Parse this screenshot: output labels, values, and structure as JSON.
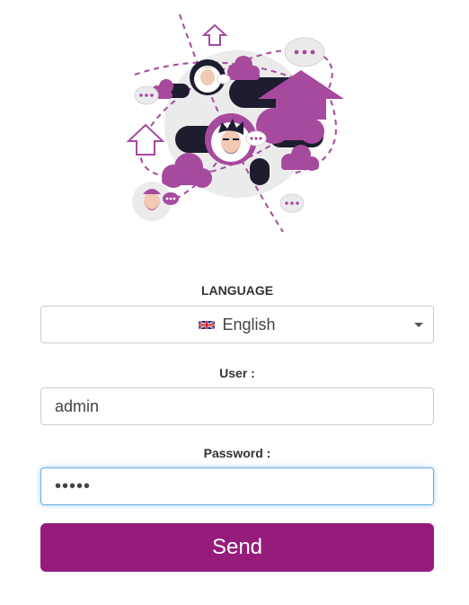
{
  "colors": {
    "accent": "#961c7c",
    "accent_light": "#a64a9e",
    "dark": "#1d1d2f",
    "focus_border": "#66afe9"
  },
  "illustration": {
    "icon": "chat-network-illustration"
  },
  "language": {
    "label": "LANGUAGE",
    "selected": "English",
    "flag_icon": "uk-flag-icon"
  },
  "user": {
    "label": "User :",
    "value": "admin"
  },
  "password": {
    "label": "Password :",
    "value": "admin"
  },
  "send": {
    "label": "Send"
  }
}
